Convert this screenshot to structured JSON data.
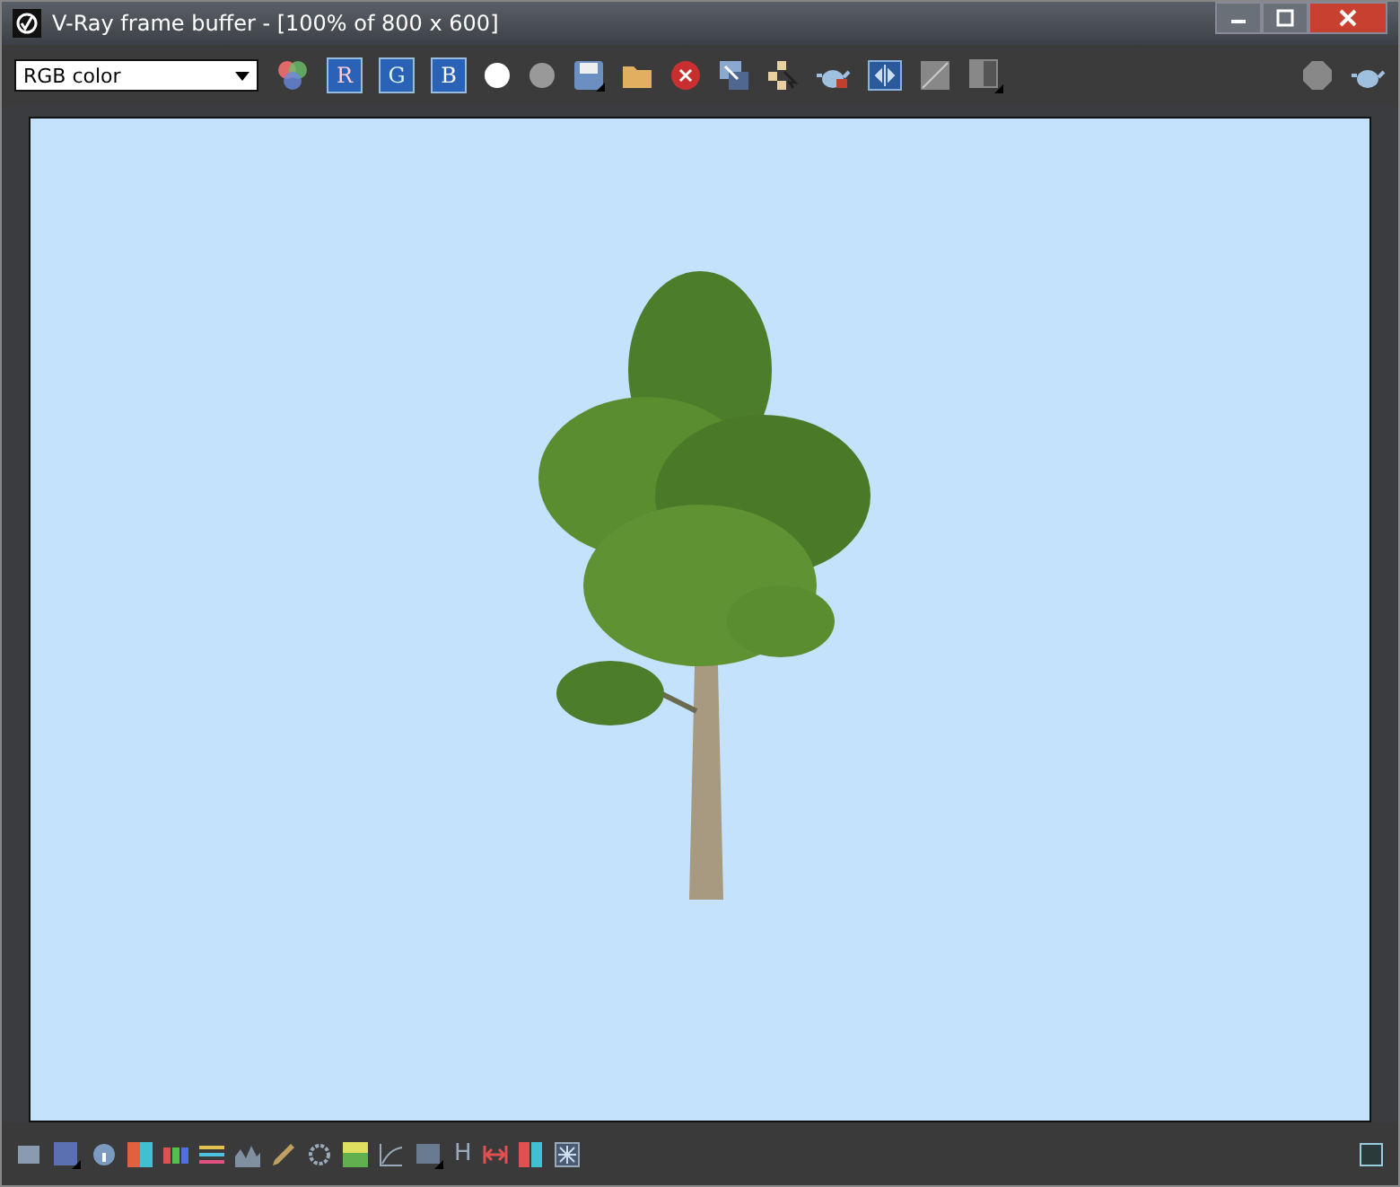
{
  "window": {
    "title": "V-Ray frame buffer - [100% of 800 x 600]"
  },
  "toolbar": {
    "channel": "RGB color",
    "channel_buttons": [
      {
        "label": "R",
        "selected": true
      },
      {
        "label": "G",
        "selected": true
      },
      {
        "label": "B",
        "selected": true
      }
    ]
  },
  "bottom_bar": {
    "histogram_label": "H"
  }
}
